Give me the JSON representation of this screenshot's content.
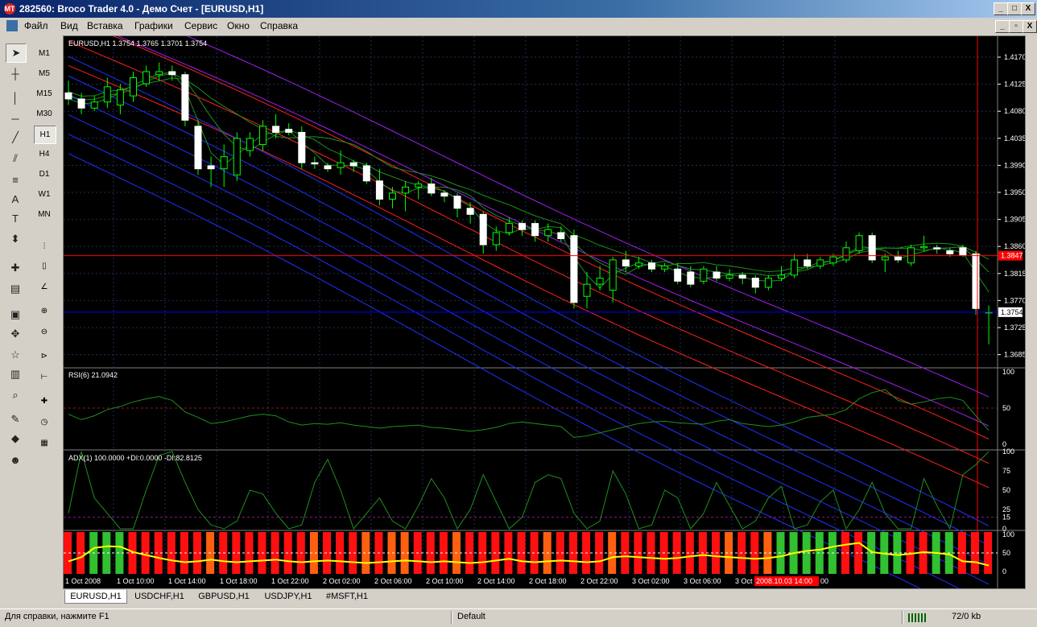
{
  "window": {
    "title": "282560: Broco Trader 4.0 - Демо Счет - [EURUSD,H1]",
    "app_icon": "MT"
  },
  "window_buttons": [
    "_",
    "□",
    "X"
  ],
  "child_buttons": [
    "_",
    "▫",
    "X"
  ],
  "menu": [
    "Файл",
    "Вид",
    "Вставка",
    "Графики",
    "Сервис",
    "Окно",
    "Справка"
  ],
  "timeframes": [
    "M1",
    "M5",
    "M15",
    "M30",
    "H1",
    "H4",
    "D1",
    "W1",
    "MN"
  ],
  "active_timeframe": "H1",
  "chart": {
    "header": "EURUSD,H1  1.3754 1.3765 1.3701 1.3754",
    "price_labels": [
      "1.4170",
      "1.4125",
      "1.4080",
      "1.4035",
      "1.3990",
      "1.3950",
      "1.3905",
      "1.3860",
      "1.3815",
      "1.3770",
      "1.3725",
      "1.3685"
    ],
    "hline_price": "1.3847",
    "current_price": "1.3754",
    "colors": {
      "bull": "#ffffff",
      "bear": "#ffffff",
      "wick": "#00ff00",
      "ask_line": "#ff0000",
      "bid_line": "#0000ff"
    }
  },
  "rsi": {
    "label": "RSI(6) 21.0942",
    "levels": [
      "100",
      "50",
      "0"
    ]
  },
  "adx": {
    "label": "ADX(1) 100.0000  +DI:0.0000  -DI:82.8125",
    "levels": [
      "100",
      "75",
      "50",
      "25",
      "15",
      "0"
    ]
  },
  "histo": {
    "levels": [
      "100",
      "50",
      "0"
    ]
  },
  "time_labels": [
    "1 Oct 2008",
    "1 Oct 10:00",
    "1 Oct 14:00",
    "1 Oct 18:00",
    "1 Oct 22:00",
    "2 Oct 02:00",
    "2 Oct 06:00",
    "2 Oct 10:00",
    "2 Oct 14:00",
    "2 Oct 18:00",
    "2 Oct 22:00",
    "3 Oct 02:00",
    "3 Oct 06:00",
    "3 Oct"
  ],
  "cursor_time": "2008.10.03 14:00",
  "time_tail": "00",
  "tabs": [
    "EURUSD,H1",
    "USDCHF,H1",
    "GBPUSD,H1",
    "USDJPY,H1",
    "#MSFT,H1"
  ],
  "status": {
    "help": "Для справки, нажмите F1",
    "profile": "Default",
    "traffic": "72/0 kb"
  },
  "chart_data": {
    "type": "candlestick",
    "series": [
      {
        "o": 1.4115,
        "h": 1.4135,
        "l": 1.4095,
        "c": 1.4105
      },
      {
        "o": 1.4105,
        "h": 1.4115,
        "l": 1.408,
        "c": 1.409
      },
      {
        "o": 1.409,
        "h": 1.411,
        "l": 1.4085,
        "c": 1.41
      },
      {
        "o": 1.41,
        "h": 1.414,
        "l": 1.409,
        "c": 1.4125
      },
      {
        "o": 1.4095,
        "h": 1.413,
        "l": 1.408,
        "c": 1.412
      },
      {
        "o": 1.411,
        "h": 1.415,
        "l": 1.41,
        "c": 1.414
      },
      {
        "o": 1.413,
        "h": 1.416,
        "l": 1.4125,
        "c": 1.415
      },
      {
        "o": 1.4145,
        "h": 1.4165,
        "l": 1.4135,
        "c": 1.415
      },
      {
        "o": 1.415,
        "h": 1.416,
        "l": 1.4135,
        "c": 1.4145
      },
      {
        "o": 1.4145,
        "h": 1.415,
        "l": 1.406,
        "c": 1.407
      },
      {
        "o": 1.406,
        "h": 1.407,
        "l": 1.398,
        "c": 1.399
      },
      {
        "o": 1.3995,
        "h": 1.401,
        "l": 1.396,
        "c": 1.399
      },
      {
        "o": 1.399,
        "h": 1.403,
        "l": 1.396,
        "c": 1.401
      },
      {
        "o": 1.398,
        "h": 1.405,
        "l": 1.397,
        "c": 1.404
      },
      {
        "o": 1.402,
        "h": 1.405,
        "l": 1.401,
        "c": 1.404
      },
      {
        "o": 1.403,
        "h": 1.407,
        "l": 1.402,
        "c": 1.406
      },
      {
        "o": 1.406,
        "h": 1.408,
        "l": 1.404,
        "c": 1.405
      },
      {
        "o": 1.4055,
        "h": 1.4065,
        "l": 1.4045,
        "c": 1.405
      },
      {
        "o": 1.405,
        "h": 1.406,
        "l": 1.399,
        "c": 1.4
      },
      {
        "o": 1.4,
        "h": 1.401,
        "l": 1.399,
        "c": 1.3998
      },
      {
        "o": 1.3995,
        "h": 1.4,
        "l": 1.3985,
        "c": 1.399
      },
      {
        "o": 1.3992,
        "h": 1.402,
        "l": 1.398,
        "c": 1.4
      },
      {
        "o": 1.4,
        "h": 1.4005,
        "l": 1.3985,
        "c": 1.3995
      },
      {
        "o": 1.3995,
        "h": 1.4,
        "l": 1.3965,
        "c": 1.397
      },
      {
        "o": 1.397,
        "h": 1.399,
        "l": 1.393,
        "c": 1.394
      },
      {
        "o": 1.394,
        "h": 1.396,
        "l": 1.3925,
        "c": 1.395
      },
      {
        "o": 1.395,
        "h": 1.397,
        "l": 1.392,
        "c": 1.396
      },
      {
        "o": 1.396,
        "h": 1.397,
        "l": 1.394,
        "c": 1.3965
      },
      {
        "o": 1.3965,
        "h": 1.3975,
        "l": 1.3945,
        "c": 1.395
      },
      {
        "o": 1.395,
        "h": 1.3955,
        "l": 1.3935,
        "c": 1.3945
      },
      {
        "o": 1.3945,
        "h": 1.395,
        "l": 1.391,
        "c": 1.3925
      },
      {
        "o": 1.3925,
        "h": 1.3935,
        "l": 1.39,
        "c": 1.3915
      },
      {
        "o": 1.3915,
        "h": 1.392,
        "l": 1.385,
        "c": 1.3865
      },
      {
        "o": 1.3865,
        "h": 1.3895,
        "l": 1.3855,
        "c": 1.3885
      },
      {
        "o": 1.3885,
        "h": 1.391,
        "l": 1.388,
        "c": 1.39
      },
      {
        "o": 1.39,
        "h": 1.3905,
        "l": 1.388,
        "c": 1.389
      },
      {
        "o": 1.39,
        "h": 1.3905,
        "l": 1.387,
        "c": 1.388
      },
      {
        "o": 1.388,
        "h": 1.39,
        "l": 1.387,
        "c": 1.389
      },
      {
        "o": 1.3885,
        "h": 1.3895,
        "l": 1.387,
        "c": 1.3875
      },
      {
        "o": 1.388,
        "h": 1.389,
        "l": 1.376,
        "c": 1.377
      },
      {
        "o": 1.378,
        "h": 1.382,
        "l": 1.376,
        "c": 1.38
      },
      {
        "o": 1.38,
        "h": 1.383,
        "l": 1.379,
        "c": 1.381
      },
      {
        "o": 1.379,
        "h": 1.3845,
        "l": 1.377,
        "c": 1.384
      },
      {
        "o": 1.384,
        "h": 1.3855,
        "l": 1.382,
        "c": 1.383
      },
      {
        "o": 1.383,
        "h": 1.3845,
        "l": 1.3825,
        "c": 1.3835
      },
      {
        "o": 1.3835,
        "h": 1.384,
        "l": 1.382,
        "c": 1.3825
      },
      {
        "o": 1.3825,
        "h": 1.3835,
        "l": 1.382,
        "c": 1.383
      },
      {
        "o": 1.3825,
        "h": 1.3835,
        "l": 1.38,
        "c": 1.3805
      },
      {
        "o": 1.382,
        "h": 1.383,
        "l": 1.3795,
        "c": 1.38
      },
      {
        "o": 1.3805,
        "h": 1.383,
        "l": 1.38,
        "c": 1.3825
      },
      {
        "o": 1.382,
        "h": 1.383,
        "l": 1.3805,
        "c": 1.381
      },
      {
        "o": 1.381,
        "h": 1.3825,
        "l": 1.3805,
        "c": 1.3815
      },
      {
        "o": 1.3815,
        "h": 1.382,
        "l": 1.38,
        "c": 1.381
      },
      {
        "o": 1.381,
        "h": 1.3815,
        "l": 1.3785,
        "c": 1.3795
      },
      {
        "o": 1.3795,
        "h": 1.3815,
        "l": 1.379,
        "c": 1.381
      },
      {
        "o": 1.381,
        "h": 1.383,
        "l": 1.3805,
        "c": 1.3815
      },
      {
        "o": 1.3815,
        "h": 1.385,
        "l": 1.381,
        "c": 1.384
      },
      {
        "o": 1.384,
        "h": 1.385,
        "l": 1.3825,
        "c": 1.383
      },
      {
        "o": 1.383,
        "h": 1.3845,
        "l": 1.3825,
        "c": 1.384
      },
      {
        "o": 1.3835,
        "h": 1.385,
        "l": 1.383,
        "c": 1.3845
      },
      {
        "o": 1.384,
        "h": 1.387,
        "l": 1.3835,
        "c": 1.386
      },
      {
        "o": 1.3855,
        "h": 1.3885,
        "l": 1.385,
        "c": 1.388
      },
      {
        "o": 1.388,
        "h": 1.3885,
        "l": 1.3835,
        "c": 1.384
      },
      {
        "o": 1.384,
        "h": 1.385,
        "l": 1.382,
        "c": 1.3845
      },
      {
        "o": 1.3845,
        "h": 1.3855,
        "l": 1.3835,
        "c": 1.384
      },
      {
        "o": 1.3835,
        "h": 1.3865,
        "l": 1.383,
        "c": 1.386
      },
      {
        "o": 1.386,
        "h": 1.388,
        "l": 1.3855,
        "c": 1.3862
      },
      {
        "o": 1.386,
        "h": 1.3865,
        "l": 1.385,
        "c": 1.3858
      },
      {
        "o": 1.3855,
        "h": 1.386,
        "l": 1.3845,
        "c": 1.385
      },
      {
        "o": 1.386,
        "h": 1.3865,
        "l": 1.3845,
        "c": 1.3848
      },
      {
        "o": 1.385,
        "h": 1.3855,
        "l": 1.375,
        "c": 1.376
      },
      {
        "o": 1.3754,
        "h": 1.3765,
        "l": 1.3701,
        "c": 1.3754
      }
    ],
    "ylim": [
      1.3665,
      1.4195
    ],
    "rsi": [
      42,
      35,
      40,
      48,
      52,
      58,
      62,
      65,
      60,
      45,
      38,
      30,
      32,
      36,
      40,
      42,
      40,
      32,
      28,
      30,
      29,
      31,
      28,
      26,
      24,
      26,
      27,
      28,
      25,
      24,
      22,
      20,
      22,
      25,
      30,
      32,
      30,
      28,
      26,
      12,
      14,
      18,
      22,
      26,
      30,
      32,
      33,
      31,
      30,
      29,
      33,
      35,
      30,
      28,
      26,
      28,
      32,
      38,
      40,
      42,
      48,
      62,
      70,
      74,
      60,
      55,
      58,
      62,
      64,
      60,
      40,
      21
    ],
    "adx": [
      20,
      100,
      40,
      20,
      0,
      0,
      50,
      95,
      100,
      60,
      25,
      5,
      0,
      10,
      50,
      45,
      20,
      0,
      5,
      60,
      90,
      50,
      0,
      20,
      40,
      10,
      0,
      30,
      65,
      40,
      0,
      25,
      70,
      35,
      0,
      15,
      60,
      70,
      65,
      20,
      0,
      10,
      75,
      45,
      0,
      5,
      50,
      40,
      0,
      20,
      60,
      30,
      0,
      10,
      40,
      55,
      0,
      5,
      35,
      50,
      0,
      25,
      60,
      20,
      0,
      0,
      65,
      30,
      0,
      70,
      83,
      100
    ],
    "histo_color": [
      "r",
      "r",
      "g",
      "g",
      "g",
      "r",
      "r",
      "r",
      "r",
      "r",
      "r",
      "o",
      "r",
      "r",
      "r",
      "r",
      "r",
      "r",
      "r",
      "o",
      "r",
      "r",
      "r",
      "o",
      "r",
      "o",
      "o",
      "r",
      "r",
      "r",
      "o",
      "r",
      "r",
      "r",
      "r",
      "r",
      "r",
      "o",
      "r",
      "r",
      "r",
      "r",
      "o",
      "r",
      "r",
      "r",
      "r",
      "r",
      "r",
      "r",
      "r",
      "o",
      "r",
      "r",
      "o",
      "g",
      "g",
      "g",
      "g",
      "g",
      "r",
      "r",
      "g",
      "g",
      "g",
      "r",
      "r",
      "g",
      "g",
      "r",
      "r",
      "r"
    ],
    "histo_line": [
      30,
      40,
      62,
      66,
      65,
      52,
      45,
      38,
      32,
      28,
      30,
      34,
      30,
      28,
      30,
      32,
      34,
      30,
      28,
      30,
      32,
      30,
      28,
      26,
      28,
      30,
      32,
      30,
      28,
      30,
      28,
      26,
      28,
      32,
      36,
      30,
      28,
      30,
      32,
      30,
      28,
      30,
      40,
      42,
      40,
      38,
      36,
      38,
      42,
      45,
      42,
      40,
      38,
      36,
      38,
      42,
      50,
      55,
      58,
      65,
      70,
      74,
      52,
      48,
      45,
      48,
      52,
      50,
      46,
      30,
      28,
      20
    ]
  }
}
